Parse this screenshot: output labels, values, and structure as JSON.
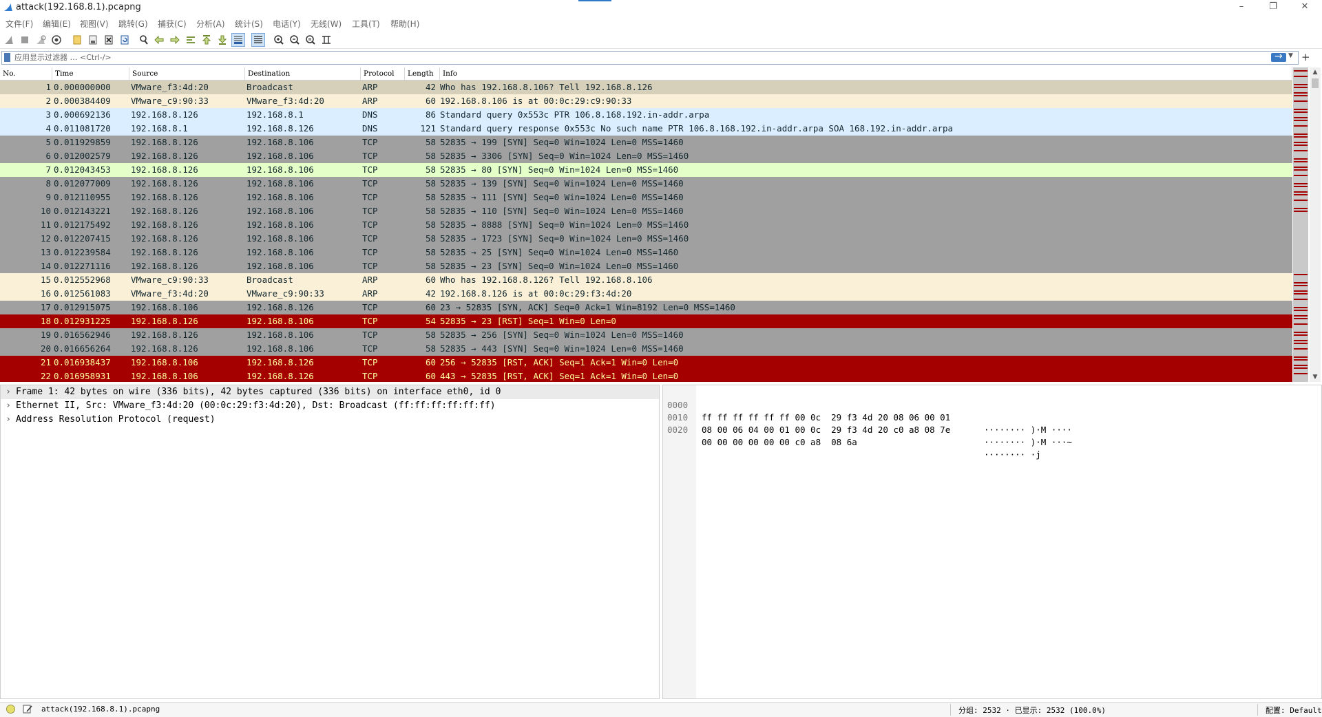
{
  "window": {
    "title": "attack(192.168.8.1).pcapng",
    "icon": "shark-fin-icon"
  },
  "menu": [
    "文件(F)",
    "编辑(E)",
    "视图(V)",
    "跳转(G)",
    "捕获(C)",
    "分析(A)",
    "统计(S)",
    "电话(Y)",
    "无线(W)",
    "工具(T)",
    "帮助(H)"
  ],
  "toolbar": {
    "icons": [
      "start-capture-icon",
      "stop-capture-icon",
      "restart-capture-icon",
      "capture-options-icon",
      "open-file-icon",
      "save-file-icon",
      "close-file-icon",
      "reload-file-icon",
      "find-packet-icon",
      "go-back-icon",
      "go-forward-icon",
      "go-to-packet-icon",
      "first-packet-icon",
      "last-packet-icon",
      "auto-scroll-icon",
      "colorize-icon",
      "zoom-in-icon",
      "zoom-out-icon",
      "normal-size-icon",
      "resize-columns-icon"
    ]
  },
  "filter": {
    "placeholder": "应用显示过滤器 … <Ctrl-/>",
    "value": "",
    "add_label": "+"
  },
  "packet_list": {
    "columns": [
      "No.",
      "Time",
      "Source",
      "Destination",
      "Protocol",
      "Length",
      "Info"
    ],
    "rows": [
      {
        "no": "1",
        "time": "0.000000000",
        "src": "VMware_f3:4d:20",
        "dst": "Broadcast",
        "proto": "ARP",
        "len": "42",
        "info": "Who has 192.168.8.106? Tell 192.168.8.126",
        "bg": "#d6d0bb",
        "fg": "#12272e"
      },
      {
        "no": "2",
        "time": "0.000384409",
        "src": "VMware_c9:90:33",
        "dst": "VMware_f3:4d:20",
        "proto": "ARP",
        "len": "60",
        "info": "192.168.8.106 is at 00:0c:29:c9:90:33",
        "bg": "#faf0d7",
        "fg": "#12272e"
      },
      {
        "no": "3",
        "time": "0.000692136",
        "src": "192.168.8.126",
        "dst": "192.168.8.1",
        "proto": "DNS",
        "len": "86",
        "info": "Standard query 0x553c PTR 106.8.168.192.in-addr.arpa",
        "bg": "#daeeff",
        "fg": "#12272e"
      },
      {
        "no": "4",
        "time": "0.011081720",
        "src": "192.168.8.1",
        "dst": "192.168.8.126",
        "proto": "DNS",
        "len": "121",
        "info": "Standard query response 0x553c No such name PTR 106.8.168.192.in-addr.arpa SOA 168.192.in-addr.arpa",
        "bg": "#daeeff",
        "fg": "#12272e"
      },
      {
        "no": "5",
        "time": "0.011929859",
        "src": "192.168.8.126",
        "dst": "192.168.8.106",
        "proto": "TCP",
        "len": "58",
        "info": "52835 → 199 [SYN] Seq=0 Win=1024 Len=0 MSS=1460",
        "bg": "#a0a0a0",
        "fg": "#12272e"
      },
      {
        "no": "6",
        "time": "0.012002579",
        "src": "192.168.8.126",
        "dst": "192.168.8.106",
        "proto": "TCP",
        "len": "58",
        "info": "52835 → 3306 [SYN] Seq=0 Win=1024 Len=0 MSS=1460",
        "bg": "#a0a0a0",
        "fg": "#12272e"
      },
      {
        "no": "7",
        "time": "0.012043453",
        "src": "192.168.8.126",
        "dst": "192.168.8.106",
        "proto": "TCP",
        "len": "58",
        "info": "52835 → 80 [SYN] Seq=0 Win=1024 Len=0 MSS=1460",
        "bg": "#e4ffc7",
        "fg": "#12272e"
      },
      {
        "no": "8",
        "time": "0.012077009",
        "src": "192.168.8.126",
        "dst": "192.168.8.106",
        "proto": "TCP",
        "len": "58",
        "info": "52835 → 139 [SYN] Seq=0 Win=1024 Len=0 MSS=1460",
        "bg": "#a0a0a0",
        "fg": "#12272e"
      },
      {
        "no": "9",
        "time": "0.012110955",
        "src": "192.168.8.126",
        "dst": "192.168.8.106",
        "proto": "TCP",
        "len": "58",
        "info": "52835 → 111 [SYN] Seq=0 Win=1024 Len=0 MSS=1460",
        "bg": "#a0a0a0",
        "fg": "#12272e"
      },
      {
        "no": "10",
        "time": "0.012143221",
        "src": "192.168.8.126",
        "dst": "192.168.8.106",
        "proto": "TCP",
        "len": "58",
        "info": "52835 → 110 [SYN] Seq=0 Win=1024 Len=0 MSS=1460",
        "bg": "#a0a0a0",
        "fg": "#12272e"
      },
      {
        "no": "11",
        "time": "0.012175492",
        "src": "192.168.8.126",
        "dst": "192.168.8.106",
        "proto": "TCP",
        "len": "58",
        "info": "52835 → 8888 [SYN] Seq=0 Win=1024 Len=0 MSS=1460",
        "bg": "#a0a0a0",
        "fg": "#12272e"
      },
      {
        "no": "12",
        "time": "0.012207415",
        "src": "192.168.8.126",
        "dst": "192.168.8.106",
        "proto": "TCP",
        "len": "58",
        "info": "52835 → 1723 [SYN] Seq=0 Win=1024 Len=0 MSS=1460",
        "bg": "#a0a0a0",
        "fg": "#12272e"
      },
      {
        "no": "13",
        "time": "0.012239584",
        "src": "192.168.8.126",
        "dst": "192.168.8.106",
        "proto": "TCP",
        "len": "58",
        "info": "52835 → 25 [SYN] Seq=0 Win=1024 Len=0 MSS=1460",
        "bg": "#a0a0a0",
        "fg": "#12272e"
      },
      {
        "no": "14",
        "time": "0.012271116",
        "src": "192.168.8.126",
        "dst": "192.168.8.106",
        "proto": "TCP",
        "len": "58",
        "info": "52835 → 23 [SYN] Seq=0 Win=1024 Len=0 MSS=1460",
        "bg": "#a0a0a0",
        "fg": "#12272e"
      },
      {
        "no": "15",
        "time": "0.012552968",
        "src": "VMware_c9:90:33",
        "dst": "Broadcast",
        "proto": "ARP",
        "len": "60",
        "info": "Who has 192.168.8.126? Tell 192.168.8.106",
        "bg": "#faf0d7",
        "fg": "#12272e"
      },
      {
        "no": "16",
        "time": "0.012561083",
        "src": "VMware_f3:4d:20",
        "dst": "VMware_c9:90:33",
        "proto": "ARP",
        "len": "42",
        "info": "192.168.8.126 is at 00:0c:29:f3:4d:20",
        "bg": "#faf0d7",
        "fg": "#12272e"
      },
      {
        "no": "17",
        "time": "0.012915075",
        "src": "192.168.8.106",
        "dst": "192.168.8.126",
        "proto": "TCP",
        "len": "60",
        "info": "23 → 52835 [SYN, ACK] Seq=0 Ack=1 Win=8192 Len=0 MSS=1460",
        "bg": "#a0a0a0",
        "fg": "#12272e"
      },
      {
        "no": "18",
        "time": "0.012931225",
        "src": "192.168.8.126",
        "dst": "192.168.8.106",
        "proto": "TCP",
        "len": "54",
        "info": "52835 → 23 [RST] Seq=1 Win=0 Len=0",
        "bg": "#a40000",
        "fg": "#fffc9c"
      },
      {
        "no": "19",
        "time": "0.016562946",
        "src": "192.168.8.126",
        "dst": "192.168.8.106",
        "proto": "TCP",
        "len": "58",
        "info": "52835 → 256 [SYN] Seq=0 Win=1024 Len=0 MSS=1460",
        "bg": "#a0a0a0",
        "fg": "#12272e"
      },
      {
        "no": "20",
        "time": "0.016656264",
        "src": "192.168.8.126",
        "dst": "192.168.8.106",
        "proto": "TCP",
        "len": "58",
        "info": "52835 → 443 [SYN] Seq=0 Win=1024 Len=0 MSS=1460",
        "bg": "#a0a0a0",
        "fg": "#12272e"
      },
      {
        "no": "21",
        "time": "0.016938437",
        "src": "192.168.8.106",
        "dst": "192.168.8.126",
        "proto": "TCP",
        "len": "60",
        "info": "256 → 52835 [RST, ACK] Seq=1 Ack=1 Win=0 Len=0",
        "bg": "#a40000",
        "fg": "#fffc9c"
      },
      {
        "no": "22",
        "time": "0.016958931",
        "src": "192.168.8.106",
        "dst": "192.168.8.126",
        "proto": "TCP",
        "len": "60",
        "info": "443 → 52835 [RST, ACK] Seq=1 Ack=1 Win=0 Len=0",
        "bg": "#a40000",
        "fg": "#fffc9c"
      }
    ]
  },
  "details": [
    "Frame 1: 42 bytes on wire (336 bits), 42 bytes captured (336 bits) on interface eth0, id 0",
    "Ethernet II, Src: VMware_f3:4d:20 (00:0c:29:f3:4d:20), Dst: Broadcast (ff:ff:ff:ff:ff:ff)",
    "Address Resolution Protocol (request)"
  ],
  "bytes": [
    {
      "offset": "0000",
      "hex": "ff ff ff ff ff ff 00 0c  29 f3 4d 20 08 06 00 01",
      "ascii": "········ )·M ····"
    },
    {
      "offset": "0010",
      "hex": "08 00 06 04 00 01 00 0c  29 f3 4d 20 c0 a8 08 7e",
      "ascii": "········ )·M ···~"
    },
    {
      "offset": "0020",
      "hex": "00 00 00 00 00 00 c0 a8  08 6a",
      "ascii": "········ ·j"
    }
  ],
  "status": {
    "file": "attack(192.168.8.1).pcapng",
    "stats": "分组: 2532 · 已显示: 2532 (100.0%)",
    "profile": "配置: Default"
  }
}
